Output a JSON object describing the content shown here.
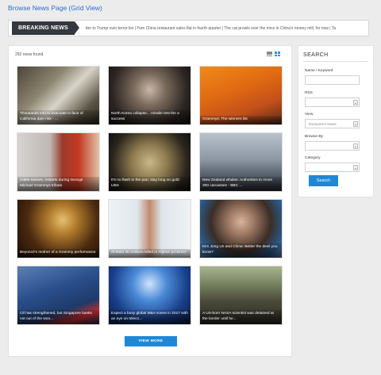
{
  "page": {
    "title": "Browse News Page (Grid View)"
  },
  "ticker": {
    "label": "BREAKING NEWS",
    "text": "tter to Trump over terror list | Yum China restaurant sales flat in fourth quarter | The cat prowls over the mice in China's money mill, for now | Ta"
  },
  "main": {
    "count_text": "292 news found.",
    "view_more_label": "VIEW MORE",
    "articles": [
      {
        "caption": "Thousands told to evacuate in face of California dam risk - ...",
        "bg": "linear-gradient(135deg,#4b4638 0%,#8c8470 35%,#d8d4c8 55%,#5a5444 80%,#2e2a22 100%)"
      },
      {
        "caption": "North Korea collapse... missile test the a success",
        "bg": "radial-gradient(circle at 50% 40%,#c9b8a8 0%,#7a6a5c 30%,#2b2522 70%,#151210 100%)"
      },
      {
        "caption": "Grammys: The winners list",
        "bg": "linear-gradient(160deg,#f08a1c 0%,#e06a12 40%,#c2501a 70%,#5a2a18 100%)"
      },
      {
        "caption": "Adele swears, restarts during George Michael Grammys tribute",
        "bg": "linear-gradient(90deg,#d6d3d0 0%,#bfb8b3 40%,#9b3a2a 55%,#c43a22 75%,#e0c4a8 100%)"
      },
      {
        "caption": "It's no flash in the pan; stay long on gold: UBS",
        "bg": "radial-gradient(circle at 50% 50%,#c9b889 0%,#8e7b4f 35%,#2a241c 75%,#111 100%)"
      },
      {
        "caption": "New Zealand whales: Authorities to move 300 carcasses - BBC ...",
        "bg": "linear-gradient(180deg,#b8c2cc 0%,#8d98a4 45%,#5c6470 70%,#2a2f36 100%)"
      },
      {
        "caption": "Beyoncé's mother of a Grammy performance",
        "bg": "radial-gradient(circle at 55% 35%,#e8c070 0%,#b07a2c 25%,#4a2a10 60%,#1a0d05 100%)"
      },
      {
        "caption": "At least 26 civilians killed in Afghan province",
        "bg": "linear-gradient(90deg,#eef2f5 0%,#dfe6ec 35%,#c08a6e 50%,#dfe6ec 65%,#eef2f5 100%)"
      },
      {
        "caption": "Kim Jong Un and China: Better the devil you know?",
        "bg": "radial-gradient(circle at 50% 38%,#d9b39a 0%,#9a7560 25%,#3a2d26 55%,#2a5a8a 80%,#6a8fb8 100%)"
      },
      {
        "caption": "Oil has strengthened, but Singapore banks not out of the woo...",
        "bg": "linear-gradient(160deg,#5d7fb5 0%,#2a4f8c 40%,#1e3a6a 70%,#c22a2a 85%,#2a3a5a 100%)"
      },
      {
        "caption": "Expect a busy global M&A scene in 2017 with an eye on teleco...",
        "bg": "radial-gradient(circle at 50% 30%,#cfe4ff 0%,#4a8ad6 30%,#1a3f8a 65%,#0a1a3a 100%)"
      },
      {
        "caption": "A US-born NASA scientist was detained at the border until he...",
        "bg": "linear-gradient(180deg,#a8b590 0%,#6f7a5c 35%,#4a4a3a 60%,#2a2a22 100%)"
      }
    ]
  },
  "sidebar": {
    "title": "SEARCH",
    "keyword_label": "Name / Keyword",
    "keyword_value": "",
    "rss_label": "RSS",
    "rss_value": "",
    "view_label": "View",
    "view_value": "Everyone's News",
    "browse_label": "Browse By",
    "browse_value": "",
    "category_label": "Category",
    "category_value": "",
    "search_label": "Search"
  }
}
